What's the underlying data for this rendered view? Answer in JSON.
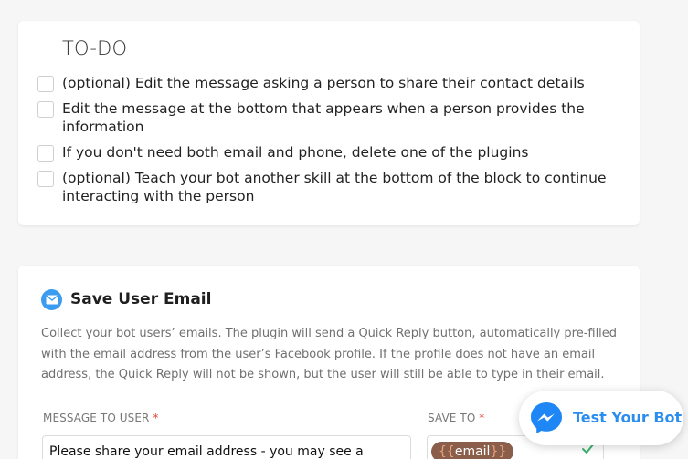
{
  "todo": {
    "title": "TO-DO",
    "items": [
      {
        "text": "(optional) Edit the message asking a person to share their contact details"
      },
      {
        "text": "Edit the message at the bottom that appears when a person provides the information"
      },
      {
        "text": "If you don't need both email and phone, delete one of the plugins"
      },
      {
        "text": "(optional) Teach your bot another skill at the bottom of the block to continue interacting with the person"
      }
    ]
  },
  "plugin": {
    "title": "Save User Email",
    "description": "Collect your bot users’ emails. The plugin will send a Quick Reply button, automatically pre-filled with the email address from the user’s Facebook profile. If the profile does not have an email address, the Quick Reply will not be shown, but the user will still be able to type in their email.",
    "message_label": "MESSAGE TO USER",
    "saveto_label": "SAVE TO",
    "required_mark": "*",
    "message_value": "Please share your email address - you may see a",
    "saveto_variable": "email",
    "brace_open": "{{",
    "brace_close": "}}"
  },
  "test_bot": {
    "label": "Test Your Bot"
  },
  "colors": {
    "accent": "#2b8df0",
    "required": "#e0463a",
    "variable_tag": "#8b5e4c",
    "check": "#3cb371"
  }
}
